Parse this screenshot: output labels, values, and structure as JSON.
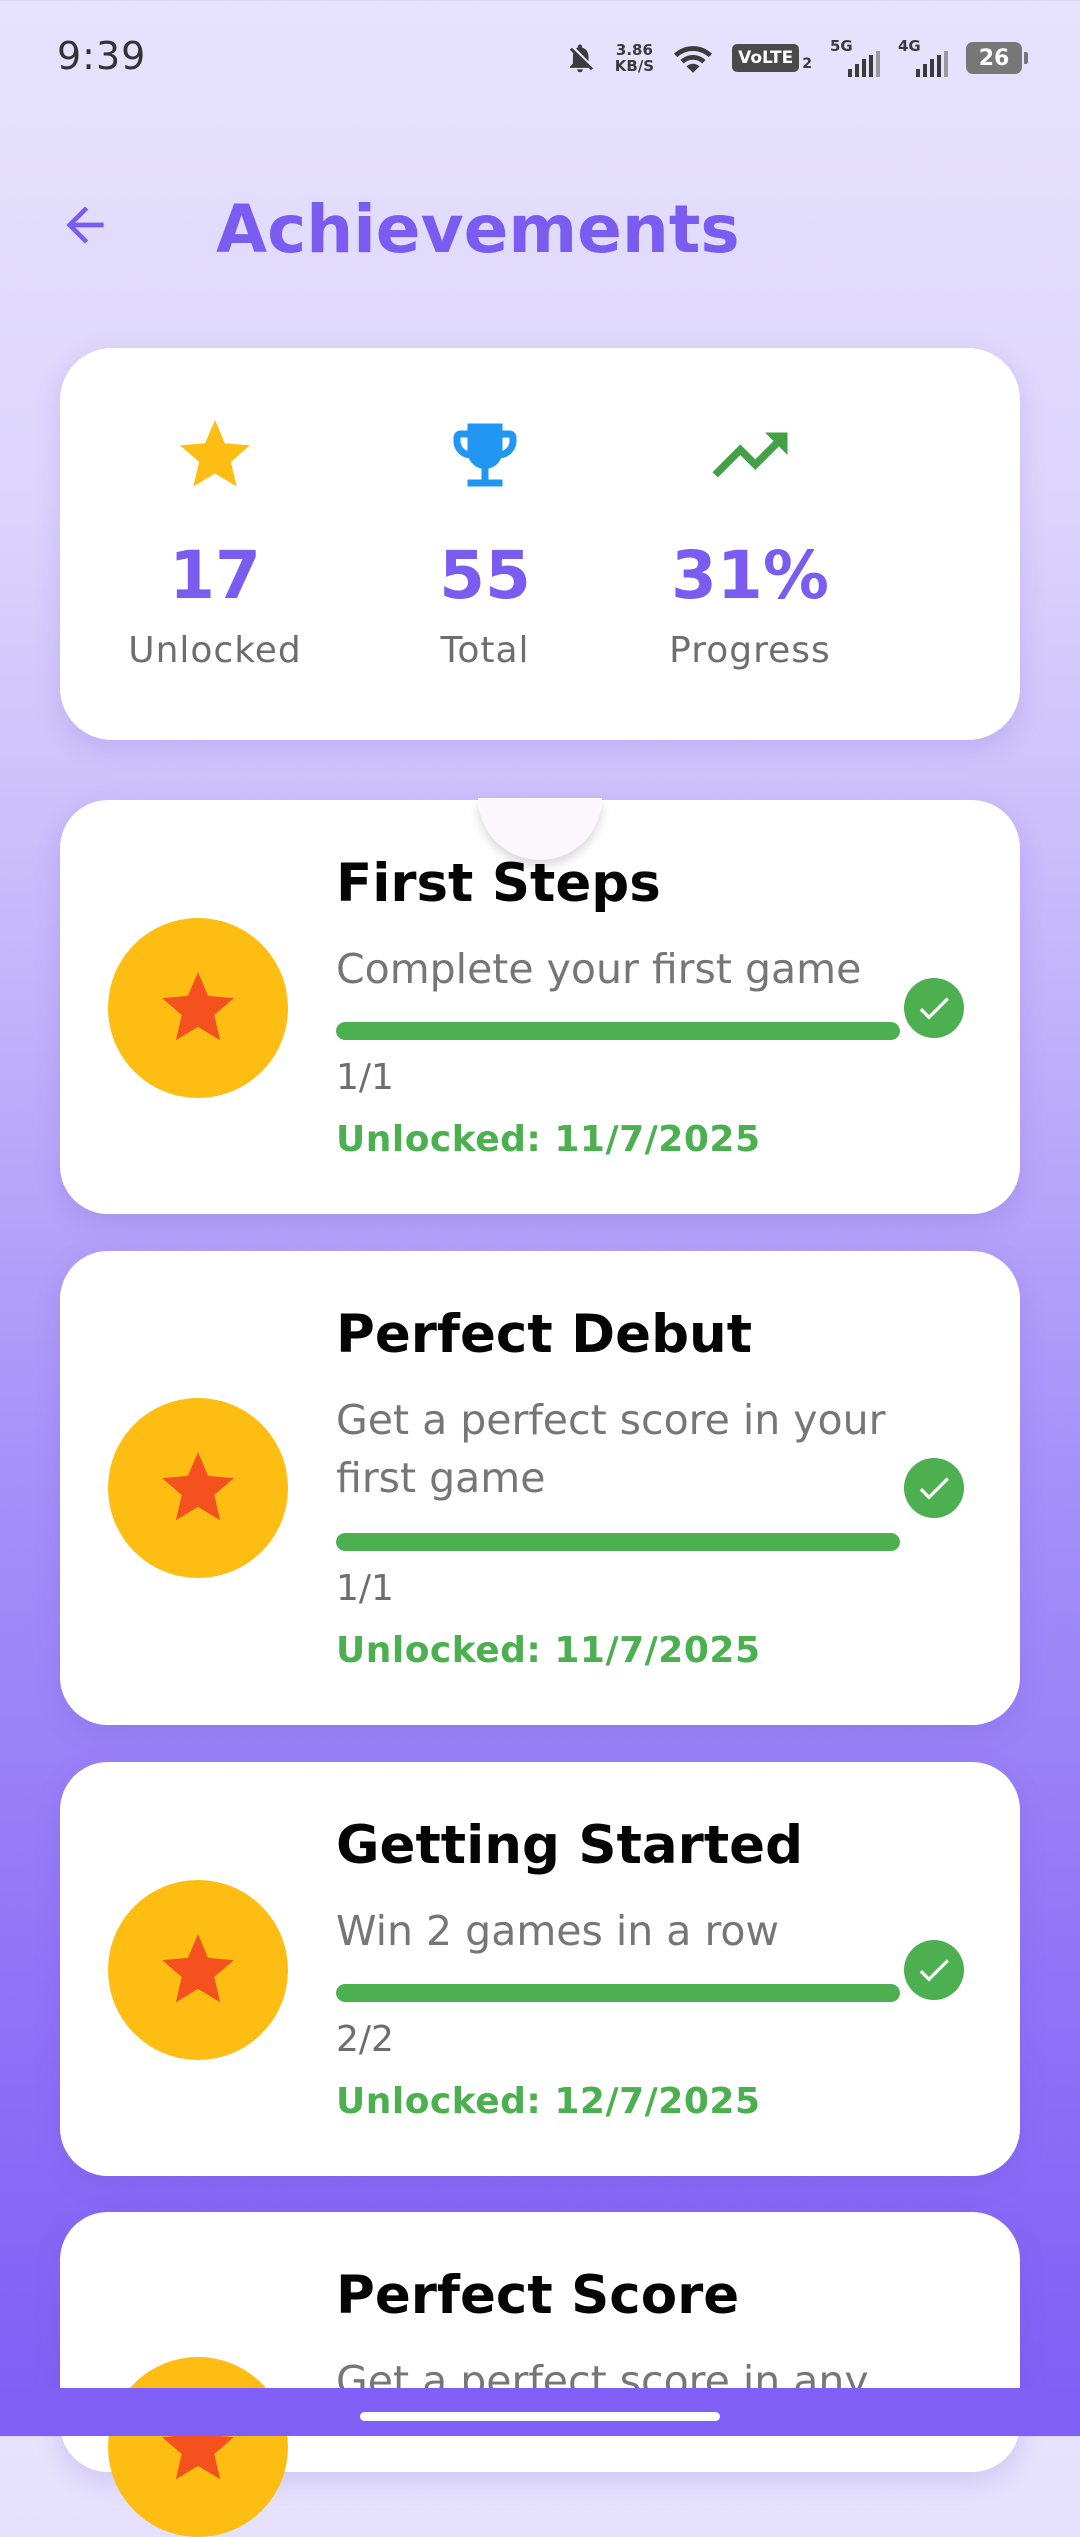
{
  "status_bar": {
    "time": "9:39",
    "net_speed_value": "3.86",
    "net_speed_unit": "KB/S",
    "volte_label": "VoLTE",
    "volte_sub": "2",
    "sig1_label": "5G",
    "sig2_label": "4G",
    "battery": "26"
  },
  "header": {
    "title": "Achievements"
  },
  "summary": {
    "unlocked_value": "17",
    "unlocked_label": "Unlocked",
    "total_value": "55",
    "total_label": "Total",
    "progress_value": "31%",
    "progress_label": "Progress"
  },
  "achievements": [
    {
      "title": "First Steps",
      "description": "Complete your first game",
      "count": "1/1",
      "progress": 1.0,
      "unlocked": "Unlocked: 11/7/2025"
    },
    {
      "title": "Perfect Debut",
      "description": "Get a perfect score in your first game",
      "count": "1/1",
      "progress": 1.0,
      "unlocked": "Unlocked: 11/7/2025"
    },
    {
      "title": "Getting Started",
      "description": "Win 2 games in a row",
      "count": "2/2",
      "progress": 1.0,
      "unlocked": "Unlocked: 12/7/2025"
    },
    {
      "title": "Perfect Score",
      "description": "Get a perfect score in any"
    }
  ],
  "colors": {
    "accent": "#7b5cf0",
    "badge": "#fdbd12",
    "badge_star": "#f4511e",
    "success": "#4caf50",
    "trophy": "#2196f3",
    "trend": "#43a047"
  },
  "icons": {
    "back": "arrow-left-icon",
    "unlocked": "star-icon",
    "total": "trophy-icon",
    "progress": "trending-up-icon",
    "badge": "star-icon",
    "status": "check-circle-icon"
  }
}
